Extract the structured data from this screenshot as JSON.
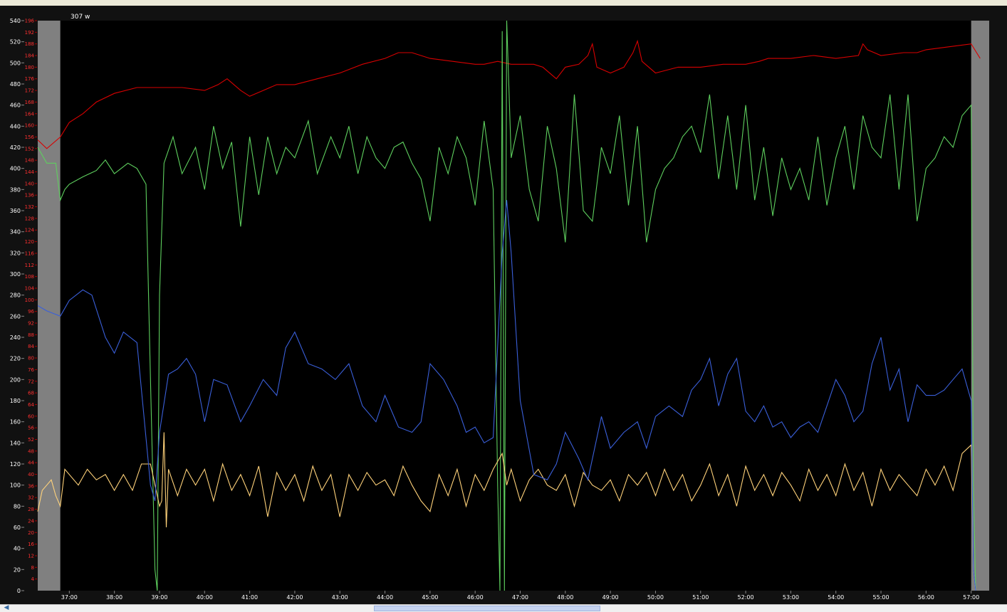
{
  "window": {
    "readout": "307 w"
  },
  "colors": {
    "background": "#000000",
    "inactive_band": "#808080",
    "power": "#3a5fd9",
    "heart_rate": "#d80000",
    "cadence": "#ffd27a",
    "speed": "#5ecf5e",
    "left_axis_text": "#ffffff",
    "right_axis_text": "#ff3030",
    "time_axis_text": "#ffffff"
  },
  "chart_data": {
    "type": "line",
    "x_unit": "minutes",
    "x_range": [
      36.3,
      57.4
    ],
    "active_range": [
      36.8,
      57.0
    ],
    "x_tick_labels": [
      "37:00",
      "38:00",
      "39:00",
      "40:00",
      "41:00",
      "42:00",
      "43:00",
      "44:00",
      "45:00",
      "46:00",
      "47:00",
      "48:00",
      "49:00",
      "50:00",
      "51:00",
      "52:00",
      "53:00",
      "54:00",
      "55:00",
      "56:00",
      "57:00"
    ],
    "x_ticks": [
      37,
      38,
      39,
      40,
      41,
      42,
      43,
      44,
      45,
      46,
      47,
      48,
      49,
      50,
      51,
      52,
      53,
      54,
      55,
      56,
      57
    ],
    "left_axis": {
      "range": [
        0,
        540
      ],
      "tick_labels": [
        "0",
        "20",
        "40",
        "60",
        "80",
        "100",
        "120",
        "140",
        "160",
        "180",
        "200",
        "220",
        "240",
        "260",
        "280",
        "300",
        "320",
        "340",
        "360",
        "380",
        "400",
        "420",
        "440",
        "460",
        "480",
        "500",
        "520",
        "540"
      ],
      "ticks": [
        0,
        20,
        40,
        60,
        80,
        100,
        120,
        140,
        160,
        180,
        200,
        220,
        240,
        260,
        280,
        300,
        320,
        340,
        360,
        380,
        400,
        420,
        440,
        460,
        480,
        500,
        520,
        540
      ]
    },
    "right_axis": {
      "range": [
        0,
        196
      ],
      "tick_labels": [
        "4",
        "8",
        "12",
        "16",
        "20",
        "24",
        "28",
        "32",
        "36",
        "40",
        "44",
        "48",
        "52",
        "56",
        "60",
        "64",
        "68",
        "72",
        "76",
        "80",
        "84",
        "88",
        "92",
        "96",
        "100",
        "104",
        "108",
        "112",
        "116",
        "120",
        "124",
        "128",
        "132",
        "136",
        "140",
        "144",
        "148",
        "152",
        "156",
        "160",
        "164",
        "168",
        "172",
        "176",
        "180",
        "184",
        "188",
        "192",
        "196"
      ],
      "ticks": [
        4,
        8,
        12,
        16,
        20,
        24,
        28,
        32,
        36,
        40,
        44,
        48,
        52,
        56,
        60,
        64,
        68,
        72,
        76,
        80,
        84,
        88,
        92,
        96,
        100,
        104,
        108,
        112,
        116,
        120,
        124,
        128,
        132,
        136,
        140,
        144,
        148,
        152,
        156,
        160,
        164,
        168,
        172,
        176,
        180,
        184,
        188,
        192,
        196
      ]
    },
    "series": [
      {
        "color_key": "heart_rate",
        "x": [
          36.3,
          36.5,
          36.8,
          37.0,
          37.3,
          37.6,
          38.0,
          38.5,
          39.0,
          39.5,
          40.0,
          40.3,
          40.5,
          40.8,
          41.0,
          41.3,
          41.6,
          42.0,
          42.5,
          43.0,
          43.5,
          44.0,
          44.3,
          44.6,
          45.0,
          45.5,
          46.0,
          46.2,
          46.5,
          46.8,
          47.0,
          47.3,
          47.5,
          47.8,
          48.0,
          48.3,
          48.5,
          48.6,
          48.7,
          49.0,
          49.3,
          49.5,
          49.6,
          49.7,
          50.0,
          50.5,
          51.0,
          51.5,
          52.0,
          52.3,
          52.5,
          53.0,
          53.5,
          54.0,
          54.5,
          54.6,
          54.7,
          55.0,
          55.5,
          55.8,
          56.0,
          56.5,
          57.0,
          57.2
        ],
        "y": [
          155,
          152,
          156,
          161,
          164,
          168,
          171,
          173,
          173,
          173,
          172,
          174,
          176,
          172,
          170,
          172,
          174,
          174,
          176,
          178,
          181,
          183,
          185,
          185,
          183,
          182,
          181,
          181,
          182,
          181,
          181,
          181,
          180,
          176,
          180,
          181,
          184,
          188,
          180,
          178,
          180,
          185,
          189,
          182,
          178,
          180,
          180,
          181,
          181,
          182,
          183,
          183,
          184,
          183,
          184,
          188,
          186,
          184,
          185,
          185,
          186,
          187,
          188,
          183
        ]
      },
      {
        "color_key": "speed",
        "x": [
          36.3,
          36.5,
          36.7,
          36.8,
          36.9,
          37.0,
          37.3,
          37.6,
          37.8,
          38.0,
          38.3,
          38.5,
          38.7,
          38.8,
          38.9,
          38.95,
          39.0,
          39.1,
          39.3,
          39.5,
          39.8,
          40.0,
          40.2,
          40.4,
          40.6,
          40.8,
          41.0,
          41.2,
          41.4,
          41.6,
          41.8,
          42.0,
          42.3,
          42.5,
          42.8,
          43.0,
          43.2,
          43.4,
          43.6,
          43.8,
          44.0,
          44.2,
          44.4,
          44.6,
          44.8,
          45.0,
          45.2,
          45.4,
          45.6,
          45.8,
          46.0,
          46.2,
          46.4,
          46.5,
          46.55,
          46.6,
          46.65,
          46.7,
          46.8,
          47.0,
          47.2,
          47.4,
          47.6,
          47.8,
          48.0,
          48.2,
          48.4,
          48.6,
          48.8,
          49.0,
          49.2,
          49.4,
          49.6,
          49.8,
          50.0,
          50.2,
          50.4,
          50.6,
          50.8,
          51.0,
          51.2,
          51.4,
          51.6,
          51.8,
          52.0,
          52.2,
          52.4,
          52.6,
          52.8,
          53.0,
          53.2,
          53.4,
          53.6,
          53.8,
          54.0,
          54.2,
          54.4,
          54.6,
          54.8,
          55.0,
          55.2,
          55.4,
          55.6,
          55.8,
          56.0,
          56.2,
          56.4,
          56.6,
          56.8,
          57.0,
          57.05,
          57.1
        ],
        "y": [
          420,
          405,
          405,
          370,
          380,
          385,
          392,
          398,
          408,
          395,
          405,
          400,
          385,
          200,
          20,
          0,
          280,
          405,
          430,
          395,
          420,
          380,
          440,
          400,
          425,
          345,
          430,
          375,
          430,
          395,
          420,
          410,
          445,
          395,
          430,
          410,
          440,
          395,
          430,
          410,
          400,
          420,
          425,
          405,
          390,
          350,
          420,
          395,
          430,
          410,
          365,
          445,
          380,
          100,
          0,
          530,
          0,
          540,
          410,
          450,
          380,
          350,
          440,
          400,
          330,
          470,
          360,
          350,
          420,
          395,
          450,
          365,
          440,
          330,
          380,
          400,
          410,
          430,
          440,
          415,
          470,
          390,
          450,
          380,
          460,
          370,
          420,
          355,
          410,
          380,
          400,
          370,
          430,
          365,
          410,
          440,
          380,
          450,
          420,
          410,
          470,
          380,
          470,
          350,
          400,
          410,
          430,
          420,
          450,
          460,
          100,
          0
        ]
      },
      {
        "color_key": "cadence",
        "x": [
          36.3,
          36.4,
          36.5,
          36.6,
          36.7,
          36.8,
          36.9,
          37.0,
          37.2,
          37.4,
          37.6,
          37.8,
          38.0,
          38.2,
          38.4,
          38.6,
          38.8,
          39.0,
          39.05,
          39.1,
          39.15,
          39.2,
          39.4,
          39.6,
          39.8,
          40.0,
          40.2,
          40.4,
          40.6,
          40.8,
          41.0,
          41.2,
          41.4,
          41.6,
          41.8,
          42.0,
          42.2,
          42.4,
          42.6,
          42.8,
          43.0,
          43.2,
          43.4,
          43.6,
          43.8,
          44.0,
          44.2,
          44.4,
          44.6,
          44.8,
          45.0,
          45.2,
          45.4,
          45.6,
          45.8,
          46.0,
          46.2,
          46.4,
          46.6,
          46.7,
          46.8,
          47.0,
          47.2,
          47.4,
          47.6,
          47.8,
          48.0,
          48.2,
          48.4,
          48.6,
          48.8,
          49.0,
          49.2,
          49.4,
          49.6,
          49.8,
          50.0,
          50.2,
          50.4,
          50.6,
          50.8,
          51.0,
          51.2,
          51.4,
          51.6,
          51.8,
          52.0,
          52.2,
          52.4,
          52.6,
          52.8,
          53.0,
          53.2,
          53.4,
          53.6,
          53.8,
          54.0,
          54.2,
          54.4,
          54.6,
          54.8,
          55.0,
          55.2,
          55.4,
          55.6,
          55.8,
          56.0,
          56.2,
          56.4,
          56.6,
          56.8,
          57.0,
          57.05,
          57.1
        ],
        "y": [
          75,
          95,
          100,
          105,
          90,
          80,
          115,
          110,
          100,
          115,
          105,
          110,
          95,
          110,
          95,
          120,
          120,
          80,
          85,
          150,
          60,
          115,
          90,
          115,
          100,
          115,
          85,
          120,
          95,
          110,
          90,
          118,
          70,
          112,
          95,
          110,
          85,
          118,
          95,
          110,
          70,
          110,
          95,
          112,
          100,
          105,
          90,
          118,
          100,
          85,
          75,
          110,
          90,
          115,
          80,
          110,
          95,
          115,
          130,
          100,
          115,
          85,
          105,
          115,
          100,
          95,
          110,
          80,
          112,
          100,
          95,
          105,
          85,
          110,
          100,
          112,
          90,
          115,
          95,
          110,
          85,
          100,
          120,
          90,
          110,
          80,
          118,
          95,
          110,
          90,
          112,
          100,
          85,
          115,
          95,
          110,
          90,
          120,
          95,
          112,
          80,
          115,
          95,
          110,
          100,
          90,
          115,
          100,
          118,
          95,
          130,
          138,
          20,
          0
        ]
      },
      {
        "color_key": "power",
        "x": [
          36.3,
          36.5,
          36.8,
          37.0,
          37.3,
          37.5,
          37.8,
          38.0,
          38.2,
          38.5,
          38.8,
          38.9,
          39.0,
          39.2,
          39.4,
          39.6,
          39.8,
          40.0,
          40.2,
          40.5,
          40.8,
          41.0,
          41.3,
          41.6,
          41.8,
          42.0,
          42.3,
          42.6,
          42.9,
          43.2,
          43.5,
          43.8,
          44.0,
          44.3,
          44.6,
          44.8,
          45.0,
          45.3,
          45.6,
          45.8,
          46.0,
          46.2,
          46.4,
          46.6,
          46.7,
          46.8,
          47.0,
          47.3,
          47.6,
          47.8,
          48.0,
          48.3,
          48.5,
          48.8,
          49.0,
          49.3,
          49.6,
          49.8,
          50.0,
          50.3,
          50.6,
          50.8,
          51.0,
          51.2,
          51.4,
          51.6,
          51.8,
          52.0,
          52.2,
          52.4,
          52.6,
          52.8,
          53.0,
          53.2,
          53.4,
          53.6,
          53.8,
          54.0,
          54.2,
          54.4,
          54.6,
          54.8,
          55.0,
          55.2,
          55.4,
          55.6,
          55.8,
          56.0,
          56.2,
          56.4,
          56.6,
          56.8,
          57.0,
          57.05,
          57.1
        ],
        "y": [
          270,
          265,
          260,
          275,
          285,
          280,
          240,
          225,
          245,
          235,
          100,
          85,
          150,
          205,
          210,
          220,
          205,
          160,
          200,
          195,
          160,
          175,
          200,
          185,
          230,
          245,
          215,
          210,
          200,
          215,
          175,
          160,
          185,
          155,
          150,
          160,
          215,
          200,
          175,
          150,
          155,
          140,
          145,
          320,
          370,
          320,
          180,
          110,
          105,
          120,
          150,
          125,
          105,
          165,
          135,
          150,
          160,
          135,
          165,
          175,
          165,
          190,
          200,
          220,
          175,
          205,
          220,
          170,
          160,
          175,
          155,
          160,
          145,
          155,
          160,
          150,
          175,
          200,
          185,
          160,
          170,
          215,
          240,
          190,
          210,
          160,
          195,
          185,
          185,
          190,
          200,
          210,
          180,
          20,
          0
        ]
      }
    ]
  }
}
